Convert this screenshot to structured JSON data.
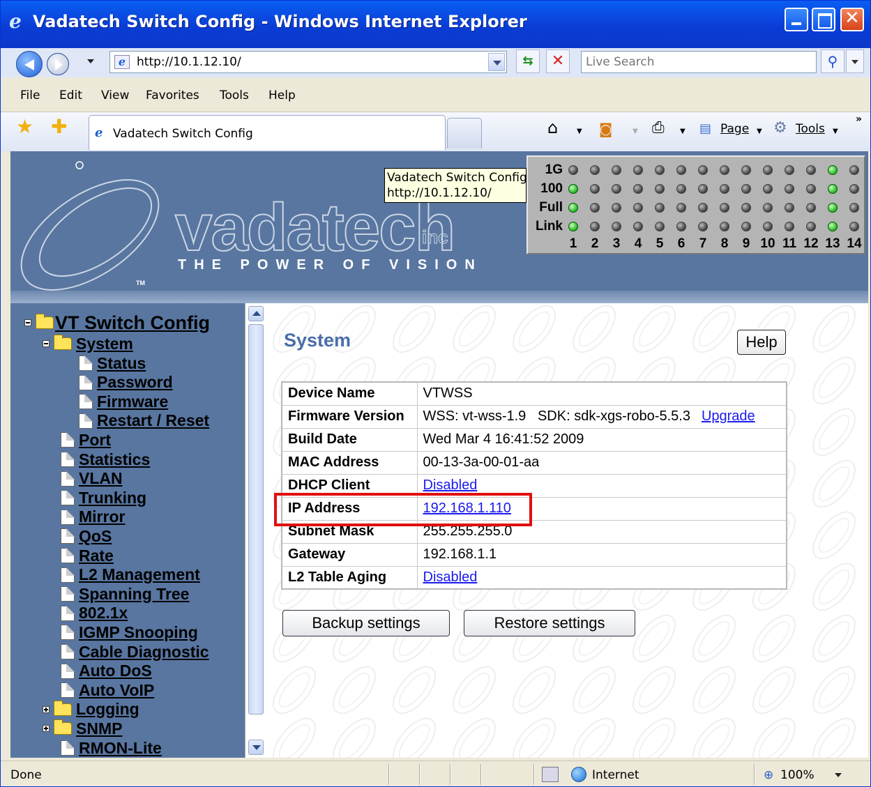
{
  "window": {
    "title": "Vadatech Switch Config - Windows Internet Explorer"
  },
  "address_bar": {
    "url": "http://10.1.12.10/"
  },
  "search": {
    "placeholder": "Live Search"
  },
  "menu": [
    "File",
    "Edit",
    "View",
    "Favorites",
    "Tools",
    "Help"
  ],
  "tab": {
    "label": "Vadatech Switch Config"
  },
  "command_bar": {
    "page_label": "Page",
    "tools_label": "Tools"
  },
  "tooltip": {
    "line1": "Vadatech Switch Config",
    "line2": "http://10.1.12.10/"
  },
  "banner": {
    "logo_word": "vadatech",
    "logo_inc": "inc",
    "tagline": "THE POWER OF VISION",
    "tm": "TM"
  },
  "port_panel": {
    "rows": [
      {
        "label": "1G",
        "on": [
          13
        ]
      },
      {
        "label": "100",
        "on": [
          1,
          13
        ]
      },
      {
        "label": "Full",
        "on": [
          1,
          13
        ]
      },
      {
        "label": "Link",
        "on": [
          1,
          13
        ]
      }
    ],
    "ports": [
      "1",
      "2",
      "3",
      "4",
      "5",
      "6",
      "7",
      "8",
      "9",
      "10",
      "11",
      "12",
      "13",
      "14"
    ]
  },
  "tree": {
    "root": "VT Switch Config",
    "system": "System",
    "system_children": [
      "Status",
      "Password",
      "Firmware",
      "Restart / Reset"
    ],
    "items": [
      "Port",
      "Statistics",
      "VLAN",
      "Trunking",
      "Mirror",
      "QoS",
      "Rate",
      "L2 Management",
      "Spanning Tree",
      "802.1x",
      "IGMP Snooping",
      "Cable Diagnostic",
      "Auto DoS",
      "Auto VoIP"
    ],
    "folders": [
      "Logging",
      "SNMP"
    ],
    "last": "RMON-Lite"
  },
  "system_page": {
    "title": "System",
    "help_label": "Help",
    "rows": [
      {
        "key": "Device Name",
        "value": "VTWSS"
      },
      {
        "key": "Firmware Version",
        "value": "WSS: vt-wss-1.9   SDK: sdk-xgs-robo-5.5.3",
        "link": "Upgrade"
      },
      {
        "key": "Build Date",
        "value": "Wed Mar 4 16:41:52 2009"
      },
      {
        "key": "MAC Address",
        "value": "00-13-3a-00-01-aa"
      },
      {
        "key": "DHCP Client",
        "link": "Disabled"
      },
      {
        "key": "IP Address",
        "link": "192.168.1.110"
      },
      {
        "key": "Subnet Mask",
        "value": "255.255.255.0"
      },
      {
        "key": "Gateway",
        "value": "192.168.1.1"
      },
      {
        "key": "L2 Table Aging",
        "link": "Disabled"
      }
    ],
    "backup_label": "Backup settings",
    "restore_label": "Restore settings"
  },
  "status_bar": {
    "text": "Done",
    "zone": "Internet",
    "zoom": "100%"
  },
  "colors": {
    "banner": "#5876a0",
    "title_blue": "#4a6da8",
    "link": "#1a1aef",
    "highlight": "#e01010",
    "led_on": "#1fb51f"
  }
}
